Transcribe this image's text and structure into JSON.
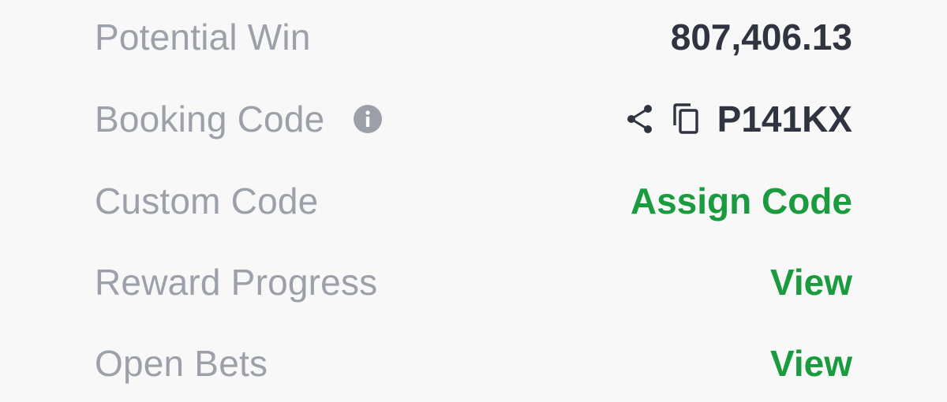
{
  "summary": {
    "potential_win": {
      "label": "Potential Win",
      "value": "807,406.13"
    },
    "booking_code": {
      "label": "Booking Code",
      "value": "P141KX",
      "icons": [
        "info-icon",
        "share-icon",
        "copy-icon"
      ]
    },
    "custom_code": {
      "label": "Custom Code",
      "action": "Assign Code"
    },
    "reward_progress": {
      "label": "Reward Progress",
      "action": "View"
    },
    "open_bets": {
      "label": "Open Bets",
      "action": "View"
    }
  },
  "colors": {
    "label": "#9ca0a8",
    "value": "#2f3440",
    "accent_green": "#1a9b3d",
    "background": "#f8f8f9"
  }
}
